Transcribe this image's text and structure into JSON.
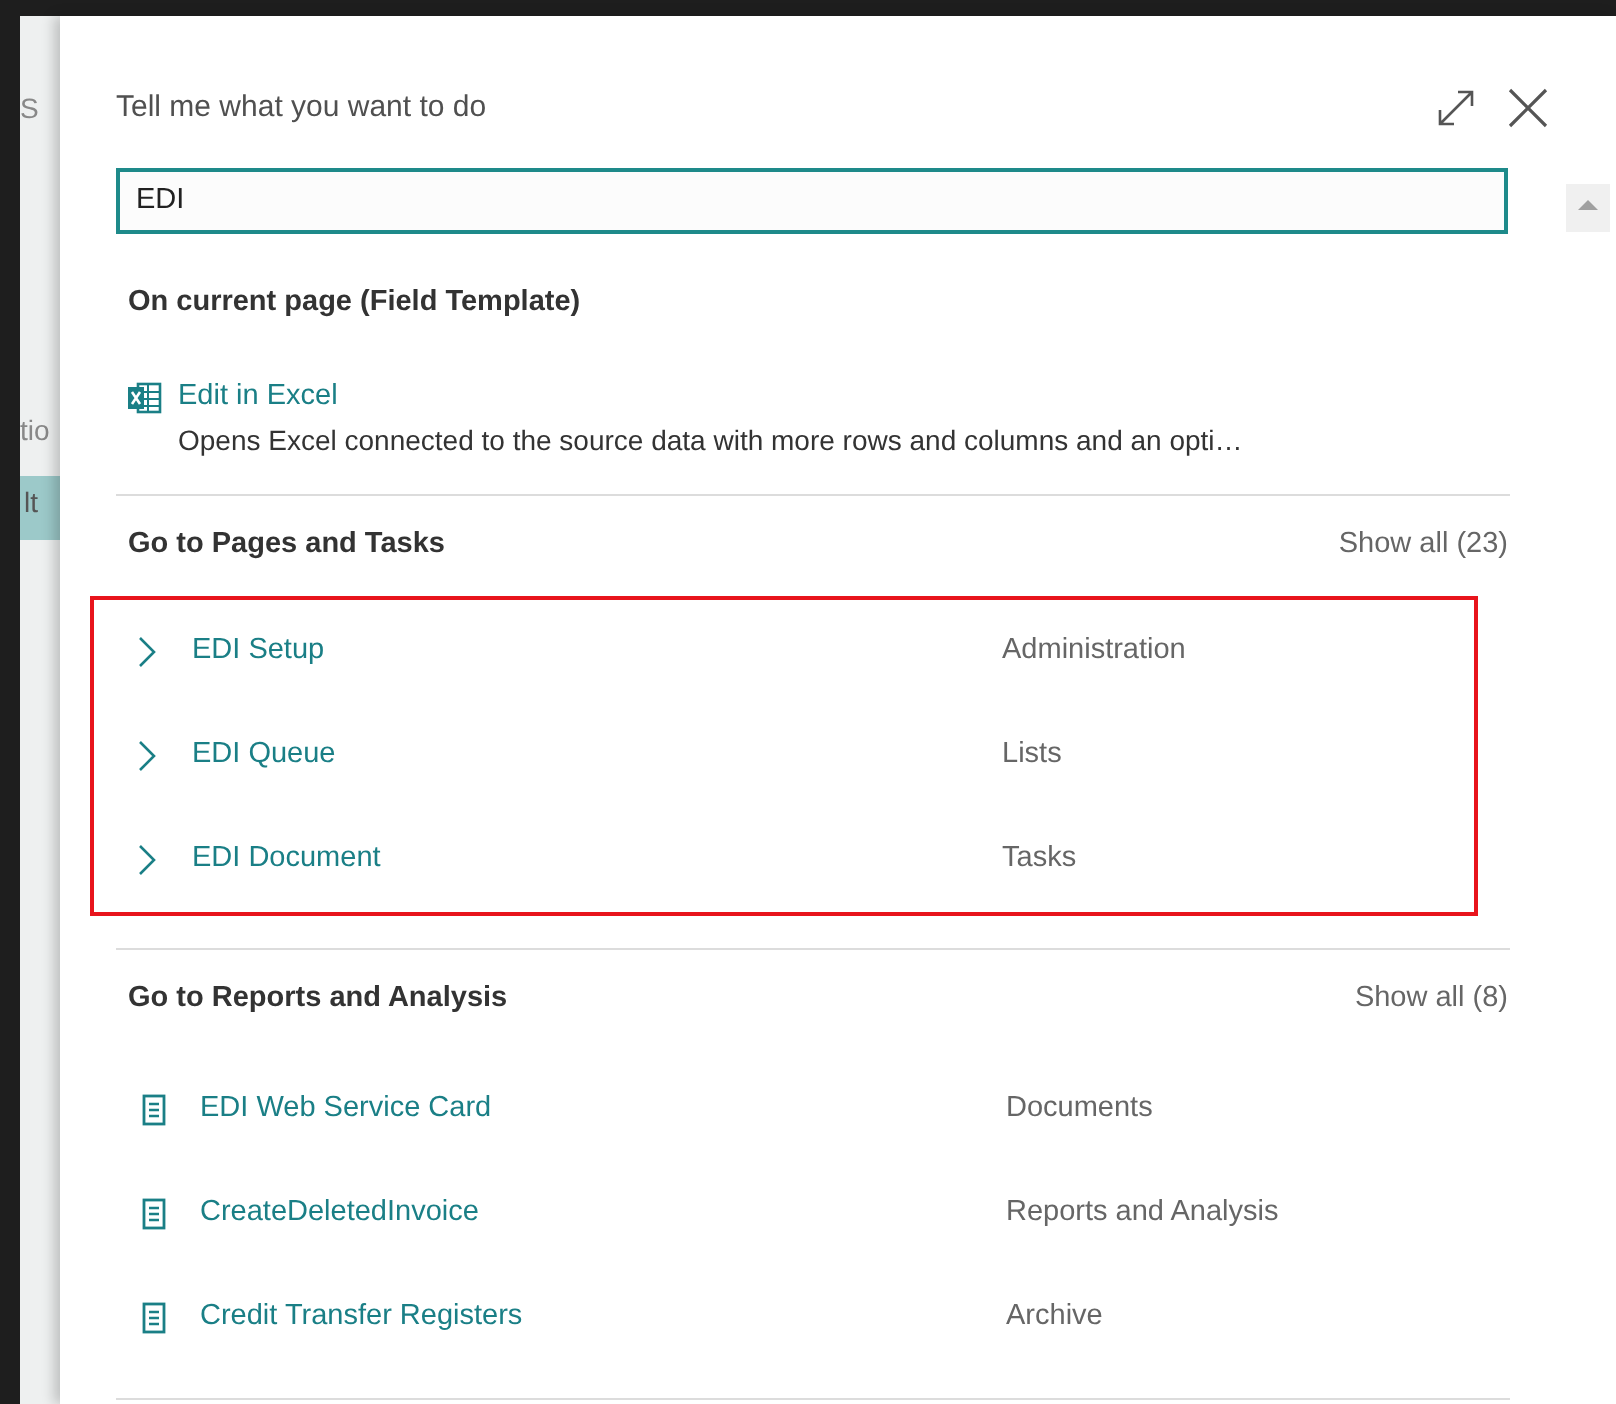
{
  "background": {
    "fragments": [
      {
        "text": "S",
        "kind": "plain"
      },
      {
        "text": "tio",
        "kind": "plain"
      },
      {
        "text": "lt",
        "kind": "selected-row"
      }
    ]
  },
  "dialog": {
    "title": "Tell me what you want to do",
    "search": {
      "value": "EDI"
    },
    "current_page": {
      "heading": "On current page (Field Template)",
      "items": [
        {
          "name": "Edit in Excel",
          "description": "Opens Excel connected to the source data with more rows and columns and an opti…"
        }
      ]
    },
    "sections": [
      {
        "heading": "Go to Pages and Tasks",
        "show_all": "Show all (23)",
        "highlighted": true,
        "items": [
          {
            "kind": "page",
            "name": "EDI Setup",
            "category": "Administration"
          },
          {
            "kind": "page",
            "name": "EDI Queue",
            "category": "Lists"
          },
          {
            "kind": "page",
            "name": "EDI Document",
            "category": "Tasks"
          }
        ]
      },
      {
        "heading": "Go to Reports and Analysis",
        "show_all": "Show all (8)",
        "highlighted": false,
        "items": [
          {
            "kind": "report",
            "name": "EDI Web Service Card",
            "category": "Documents"
          },
          {
            "kind": "report",
            "name": "CreateDeletedInvoice",
            "category": "Reports and Analysis"
          },
          {
            "kind": "report",
            "name": "Credit Transfer Registers",
            "category": "Archive"
          }
        ]
      }
    ]
  }
}
